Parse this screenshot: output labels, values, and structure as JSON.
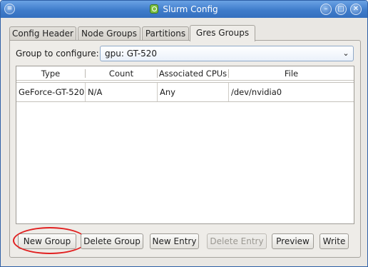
{
  "window": {
    "title": "Slurm Config",
    "menu_icon": "window-menu-icon",
    "controls": [
      "minimize-icon",
      "maximize-icon",
      "close-icon"
    ]
  },
  "tabs": [
    {
      "label": "Config Header",
      "active": false
    },
    {
      "label": "Node Groups",
      "active": false
    },
    {
      "label": "Partitions",
      "active": false
    },
    {
      "label": "Gres Groups",
      "active": true
    }
  ],
  "group": {
    "label": "Group to configure:",
    "selected": "gpu:  GT-520"
  },
  "table": {
    "columns": [
      "Type",
      "Count",
      "Associated CPUs",
      "File"
    ],
    "rows": [
      [
        "GeForce-GT-520",
        "N/A",
        "Any",
        "/dev/nvidia0"
      ]
    ]
  },
  "buttons": {
    "new_group": "New Group",
    "delete_group": "Delete Group",
    "new_entry": "New Entry",
    "delete_entry": "Delete Entry",
    "preview": "Preview",
    "write": "Write"
  },
  "colors": {
    "titlebar": "#3f7ccb",
    "highlight": "#e12020"
  }
}
